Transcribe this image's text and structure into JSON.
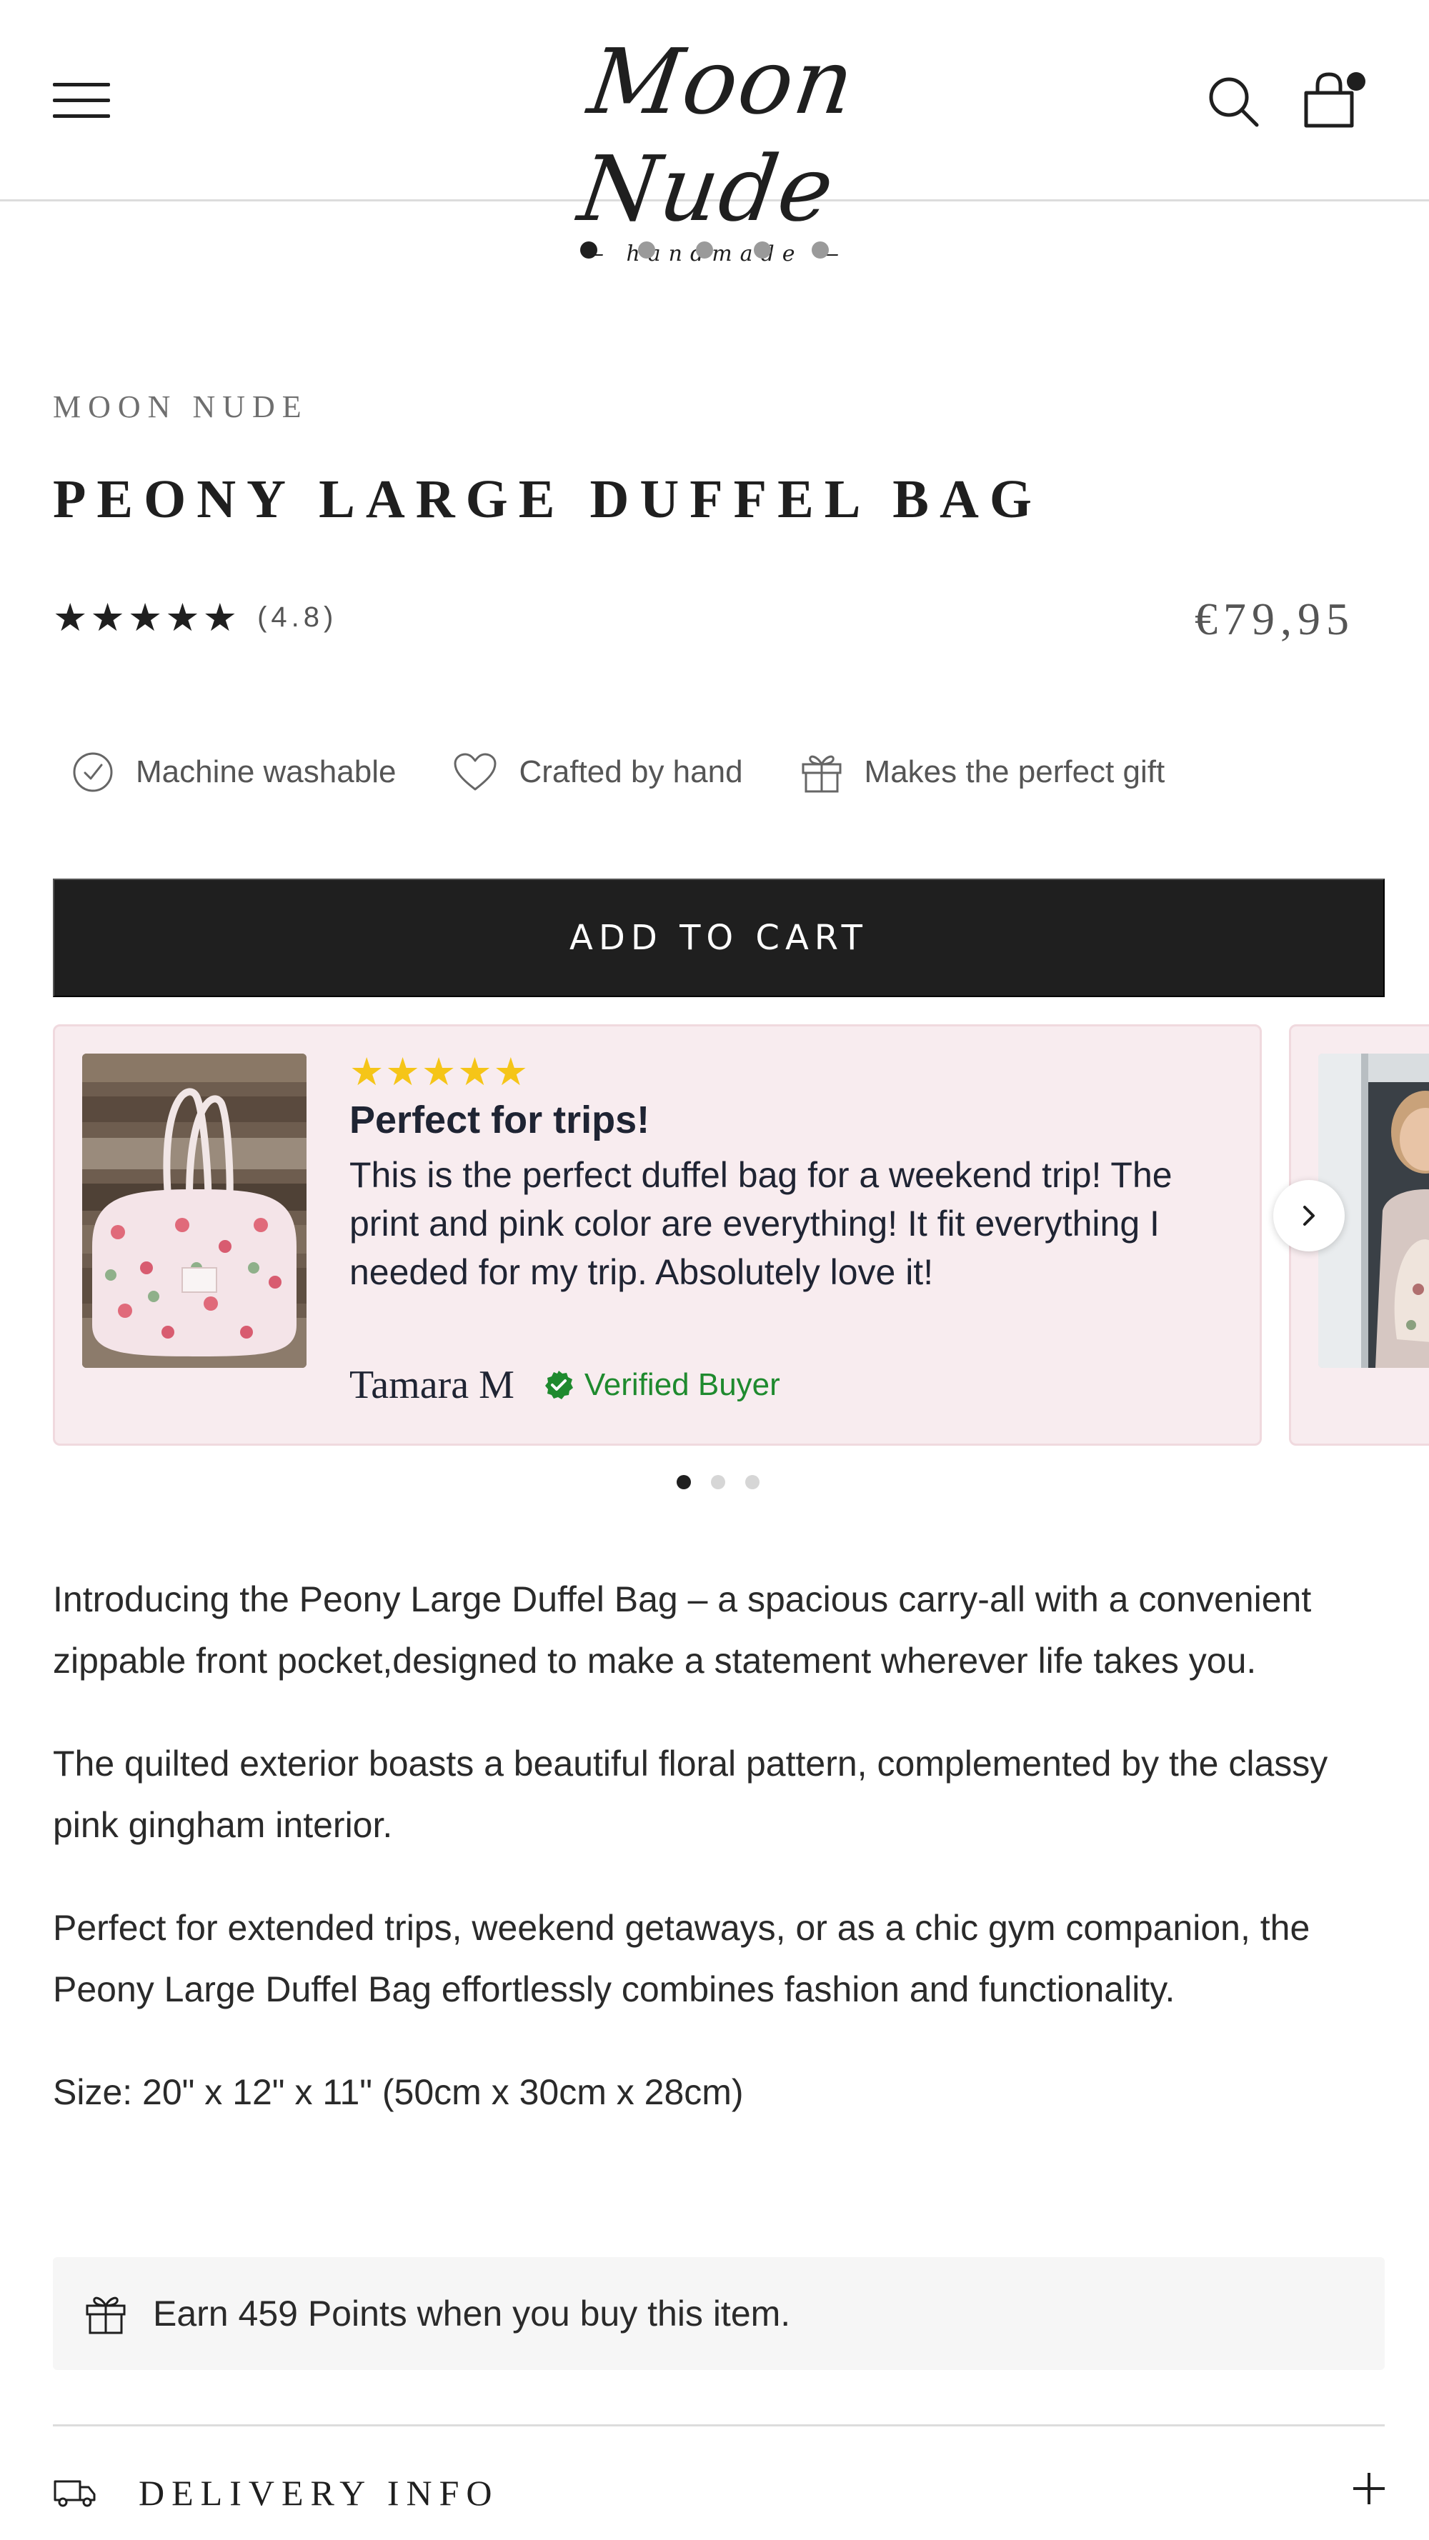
{
  "header": {
    "logo_main": "Moon Nude",
    "logo_sub": "— handmade —",
    "cart_has_items": true
  },
  "gallery": {
    "dot_count": 5,
    "active_index": 0
  },
  "product": {
    "brand": "MOON NUDE",
    "title": "PEONY LARGE DUFFEL BAG",
    "stars": "★★★★★",
    "rating": "(4.8)",
    "price": "€79,95",
    "features": [
      {
        "label": "Machine washable",
        "icon": "check-circle-icon"
      },
      {
        "label": "Crafted by hand",
        "icon": "heart-icon"
      },
      {
        "label": "Makes the perfect gift",
        "icon": "gift-icon"
      }
    ],
    "add_to_cart_label": "ADD TO CART"
  },
  "reviews": {
    "items": [
      {
        "stars": "★★★★★",
        "title": "Perfect for trips!",
        "text": "This is the perfect duffel bag for a weekend trip! The print and pink color are everything! It fit everything I needed for my trip. Absolutely love it!",
        "reviewer": "Tamara M",
        "verified_label": "Verified Buyer"
      }
    ],
    "dot_count": 3,
    "active_index": 0
  },
  "description": {
    "paragraphs": [
      "Introducing the Peony Large Duffel Bag – a spacious carry-all with a convenient zippable front pocket,designed to make a statement wherever life takes you.",
      "The quilted exterior boasts a beautiful floral pattern, complemented by the classy pink gingham interior.",
      "Perfect for extended trips, weekend getaways, or as a chic gym companion, the Peony Large Duffel Bag effortlessly combines fashion and functionality.",
      "Size: 20\" x 12\" x 11\" (50cm x 30cm x 28cm)"
    ]
  },
  "points": {
    "text": "Earn 459 Points when you buy this item."
  },
  "delivery": {
    "label": "DELIVERY INFO"
  },
  "colors": {
    "accent": "#1f1f1f",
    "review_bg": "#f8ecef",
    "star_yellow": "#f5c518",
    "verified_green": "#1f8a2e"
  }
}
